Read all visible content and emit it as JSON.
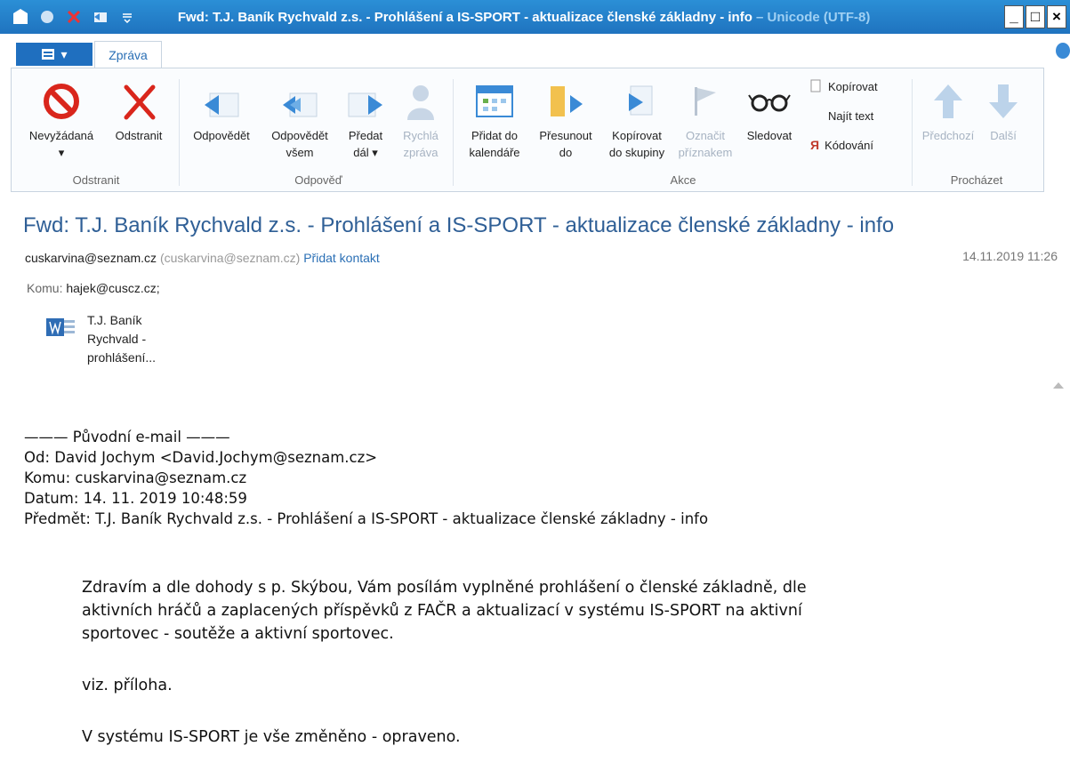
{
  "window": {
    "title": "Fwd: T.J. Baník Rychvald z.s. - Prohlášení a IS-SPORT - aktualizace členské základny - info",
    "encoding": " – Unicode (UTF-8)",
    "min": "_",
    "max": "□",
    "close": "×"
  },
  "ribbon": {
    "tab": "Zpráva",
    "groups": {
      "odstranit": "Odstranit",
      "odpoved": "Odpověď",
      "akce": "Akce",
      "prochazet": "Procházet"
    },
    "buttons": {
      "nevyzadana": "Nevyžádaná",
      "odstranit": "Odstranit",
      "odpovedet": "Odpovědět",
      "odpovedet_vsem": "Odpovědět\nvšem",
      "predat_dal": "Předat\ndál ▾",
      "rychla_zprava": "Rychlá\nzpráva",
      "pridat_kalendar": "Přidat do\nkalendáře",
      "presunout": "Přesunout\ndo",
      "kopirovat_skupiny": "Kopírovat\ndo skupiny",
      "oznacit": "Označit\npříznakem",
      "sledovat": "Sledovat",
      "kopirovat": "Kopírovat",
      "najit_text": "Najít text",
      "kodovani": "Kódování",
      "predchozi": "Předchozí",
      "dalsi": "Další"
    },
    "colors": {
      "accent": "#1f73bf",
      "red": "#d9261c",
      "disabled": "#a7b3c2"
    }
  },
  "message": {
    "subject": "Fwd: T.J. Baník Rychvald z.s. - Prohlášení a IS-SPORT - aktualizace členské základny - info",
    "from_name": "cuskarvina@seznam.cz",
    "from_mail": "(cuskarvina@seznam.cz)",
    "add_contact": "Přidat kontakt",
    "date": "14.11.2019 11:26",
    "to_label": "Komu:",
    "to_value": "hajek@cuscz.cz;",
    "attachment": "T.J. Baník\nRychvald -\nprohlášení..."
  },
  "body": {
    "orig_header": "——— Původní e-mail ———",
    "from": "Od: David Jochym <David.Jochym@seznam.cz>",
    "to": "Komu: cuskarvina@seznam.cz",
    "date": "Datum: 14. 11. 2019 10:48:59",
    "subject": "Předmět: T.J. Baník Rychvald z.s. - Prohlášení a IS-SPORT - aktualizace členské základny - info",
    "p1_l1": "Zdravím a dle dohody s p. Skýbou, Vám posílám vyplněné prohlášení o členské základně, dle",
    "p1_l2": "aktivních hráčů a zaplacených příspěvků z FAČR a aktualizací v systému IS-SPORT na aktivní",
    "p1_l3": "sportovec - soutěže a  aktivní sportovec.",
    "p2": "viz. příloha.",
    "p3": "V systému IS-SPORT je vše změněno - opraveno."
  }
}
